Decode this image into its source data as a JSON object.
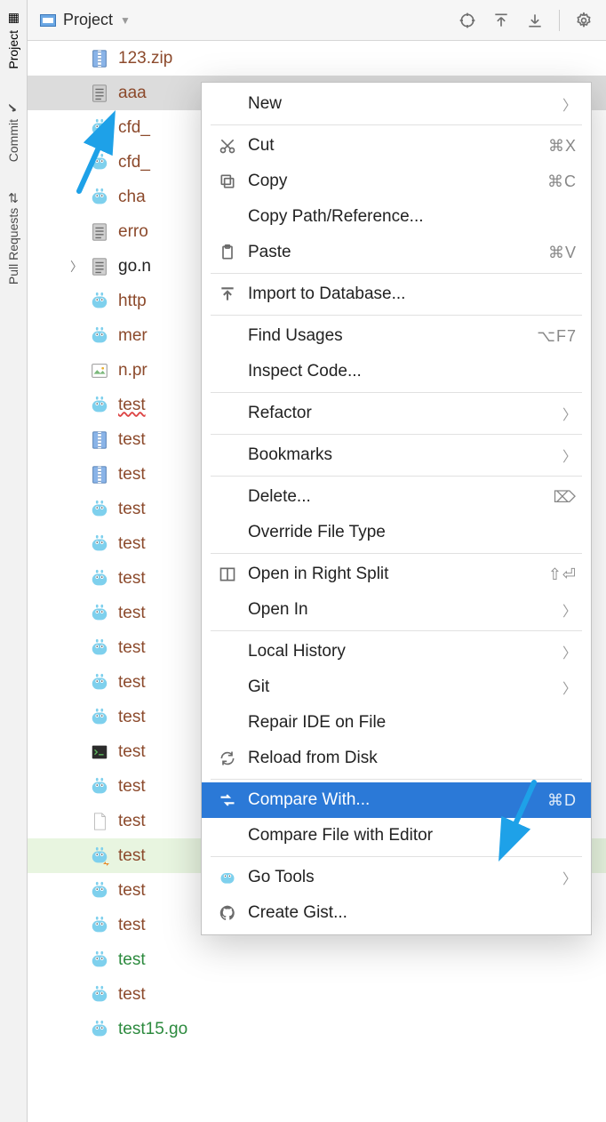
{
  "sidebar": {
    "tabs": [
      "Project",
      "Commit",
      "Pull Requests"
    ]
  },
  "header": {
    "title": "Project"
  },
  "tree": {
    "rows": [
      {
        "icon": "zip",
        "label": "123.zip",
        "color": "brown"
      },
      {
        "icon": "txt",
        "label": "aaa",
        "color": "brown",
        "selected": true
      },
      {
        "icon": "go",
        "label": "cfd_",
        "color": "brown"
      },
      {
        "icon": "go",
        "label": "cfd_",
        "color": "brown"
      },
      {
        "icon": "go",
        "label": "cha",
        "color": "brown"
      },
      {
        "icon": "txt",
        "label": "erro",
        "color": "brown"
      },
      {
        "icon": "txt",
        "label": "go.n",
        "color": "black",
        "chev": true
      },
      {
        "icon": "go",
        "label": "http",
        "color": "brown"
      },
      {
        "icon": "go",
        "label": "mer",
        "color": "brown"
      },
      {
        "icon": "img",
        "label": "n.pr",
        "color": "brown"
      },
      {
        "icon": "go",
        "label": "test",
        "color": "brown",
        "err": true
      },
      {
        "icon": "zip",
        "label": "test",
        "color": "brown"
      },
      {
        "icon": "zip",
        "label": "test",
        "color": "brown"
      },
      {
        "icon": "go",
        "label": "test",
        "color": "brown"
      },
      {
        "icon": "go",
        "label": "test",
        "color": "brown"
      },
      {
        "icon": "go",
        "label": "test",
        "color": "brown"
      },
      {
        "icon": "go",
        "label": "test",
        "color": "brown"
      },
      {
        "icon": "go",
        "label": "test",
        "color": "brown"
      },
      {
        "icon": "go",
        "label": "test",
        "color": "brown"
      },
      {
        "icon": "go",
        "label": "test",
        "color": "brown"
      },
      {
        "icon": "term",
        "label": "test",
        "color": "brown"
      },
      {
        "icon": "go",
        "label": "test",
        "color": "brown"
      },
      {
        "icon": "file",
        "label": "test",
        "color": "brown"
      },
      {
        "icon": "go",
        "label": "test",
        "color": "brown",
        "hl": true,
        "overlay": true
      },
      {
        "icon": "go",
        "label": "test",
        "color": "brown"
      },
      {
        "icon": "go",
        "label": "test",
        "color": "brown"
      },
      {
        "icon": "go",
        "label": "test",
        "color": "green"
      },
      {
        "icon": "go",
        "label": "test",
        "color": "brown"
      },
      {
        "icon": "go",
        "label": "test15.go",
        "color": "green"
      }
    ]
  },
  "menu": {
    "items": [
      {
        "label": "New",
        "sub": true
      },
      {
        "sep": true
      },
      {
        "icon": "cut",
        "label": "Cut",
        "short": "⌘X"
      },
      {
        "icon": "copy",
        "label": "Copy",
        "short": "⌘C"
      },
      {
        "label": "Copy Path/Reference..."
      },
      {
        "icon": "paste",
        "label": "Paste",
        "short": "⌘V"
      },
      {
        "sep": true
      },
      {
        "icon": "import",
        "label": "Import to Database..."
      },
      {
        "sep": true
      },
      {
        "label": "Find Usages",
        "short": "⌥F7"
      },
      {
        "label": "Inspect Code..."
      },
      {
        "sep": true
      },
      {
        "label": "Refactor",
        "sub": true
      },
      {
        "sep": true
      },
      {
        "label": "Bookmarks",
        "sub": true
      },
      {
        "sep": true
      },
      {
        "label": "Delete...",
        "short": "⌦"
      },
      {
        "label": "Override File Type"
      },
      {
        "sep": true
      },
      {
        "icon": "split",
        "label": "Open in Right Split",
        "short": "⇧⏎"
      },
      {
        "label": "Open In",
        "sub": true
      },
      {
        "sep": true
      },
      {
        "label": "Local History",
        "sub": true
      },
      {
        "label": "Git",
        "sub": true
      },
      {
        "label": "Repair IDE on File"
      },
      {
        "icon": "reload",
        "label": "Reload from Disk"
      },
      {
        "sep": true
      },
      {
        "icon": "compare",
        "label": "Compare With...",
        "short": "⌘D",
        "sel": true
      },
      {
        "label": "Compare File with Editor"
      },
      {
        "sep": true
      },
      {
        "icon": "go",
        "label": "Go Tools",
        "sub": true
      },
      {
        "icon": "gh",
        "label": "Create Gist..."
      }
    ]
  }
}
